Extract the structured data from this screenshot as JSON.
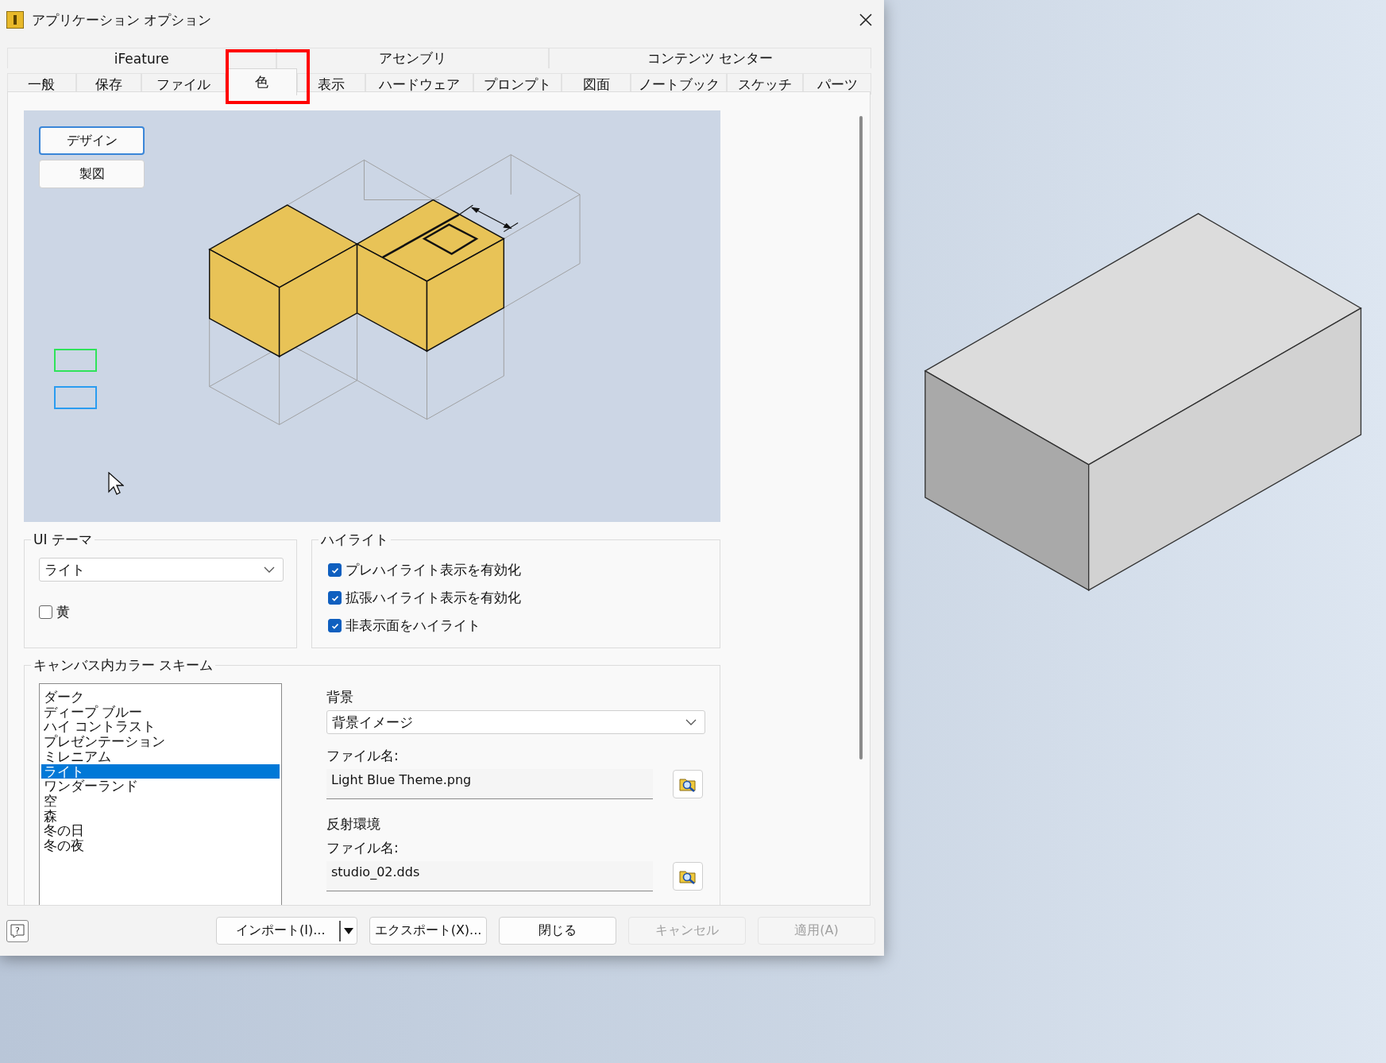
{
  "window": {
    "title": "アプリケーション オプション"
  },
  "tab_groups": [
    {
      "label": "iFeature"
    },
    {
      "label": "アセンブリ"
    },
    {
      "label": "コンテンツ センター"
    }
  ],
  "tabs": [
    {
      "label": "一般",
      "selected": false
    },
    {
      "label": "保存",
      "selected": false
    },
    {
      "label": "ファイル",
      "selected": false
    },
    {
      "label": "色",
      "selected": true
    },
    {
      "label": "表示",
      "selected": false
    },
    {
      "label": "ハードウェア",
      "selected": false
    },
    {
      "label": "プロンプト",
      "selected": false
    },
    {
      "label": "図面",
      "selected": false
    },
    {
      "label": "ノートブック",
      "selected": false
    },
    {
      "label": "スケッチ",
      "selected": false
    },
    {
      "label": "パーツ",
      "selected": false
    }
  ],
  "preview": {
    "mode_buttons": [
      {
        "label": "デザイン",
        "selected": true
      },
      {
        "label": "製図",
        "selected": false
      }
    ]
  },
  "ui_theme": {
    "title": "UI テーマ",
    "theme": "ライト",
    "options": [
      {
        "label": "黄",
        "checked": false
      }
    ]
  },
  "highlight": {
    "title": "ハイライト",
    "options": [
      {
        "label": "プレハイライト表示を有効化",
        "checked": true
      },
      {
        "label": "拡張ハイライト表示を有効化",
        "checked": true
      },
      {
        "label": "非表示面をハイライト",
        "checked": true
      }
    ]
  },
  "canvas_color_scheme": {
    "title": "キャンバス内カラー スキーム",
    "schemes": [
      {
        "label": "ダーク",
        "selected": false
      },
      {
        "label": "ディープ ブルー",
        "selected": false
      },
      {
        "label": "ハイ コントラスト",
        "selected": false
      },
      {
        "label": "プレゼンテーション",
        "selected": false
      },
      {
        "label": "ミレニアム",
        "selected": false
      },
      {
        "label": "ライト",
        "selected": true
      },
      {
        "label": "ワンダーランド",
        "selected": false
      },
      {
        "label": "空",
        "selected": false
      },
      {
        "label": "森",
        "selected": false
      },
      {
        "label": "冬の日",
        "selected": false
      },
      {
        "label": "冬の夜",
        "selected": false
      }
    ],
    "background": {
      "label": "背景",
      "value": "背景イメージ",
      "file_label": "ファイル名:",
      "file_name": "Light Blue Theme.png"
    },
    "reflection": {
      "label": "反射環境",
      "file_label": "ファイル名:",
      "file_name": "studio_02.dds"
    }
  },
  "footer": {
    "help_icon": "?",
    "buttons": [
      {
        "label": "インポート(I)...",
        "kind": "split",
        "disabled": false
      },
      {
        "label": "エクスポート(X)...",
        "kind": "plain",
        "disabled": false
      },
      {
        "label": "閉じる",
        "kind": "plain",
        "disabled": false
      },
      {
        "label": "キャンセル",
        "kind": "plain",
        "disabled": true
      },
      {
        "label": "適用(A)",
        "kind": "plain",
        "disabled": true
      }
    ]
  }
}
